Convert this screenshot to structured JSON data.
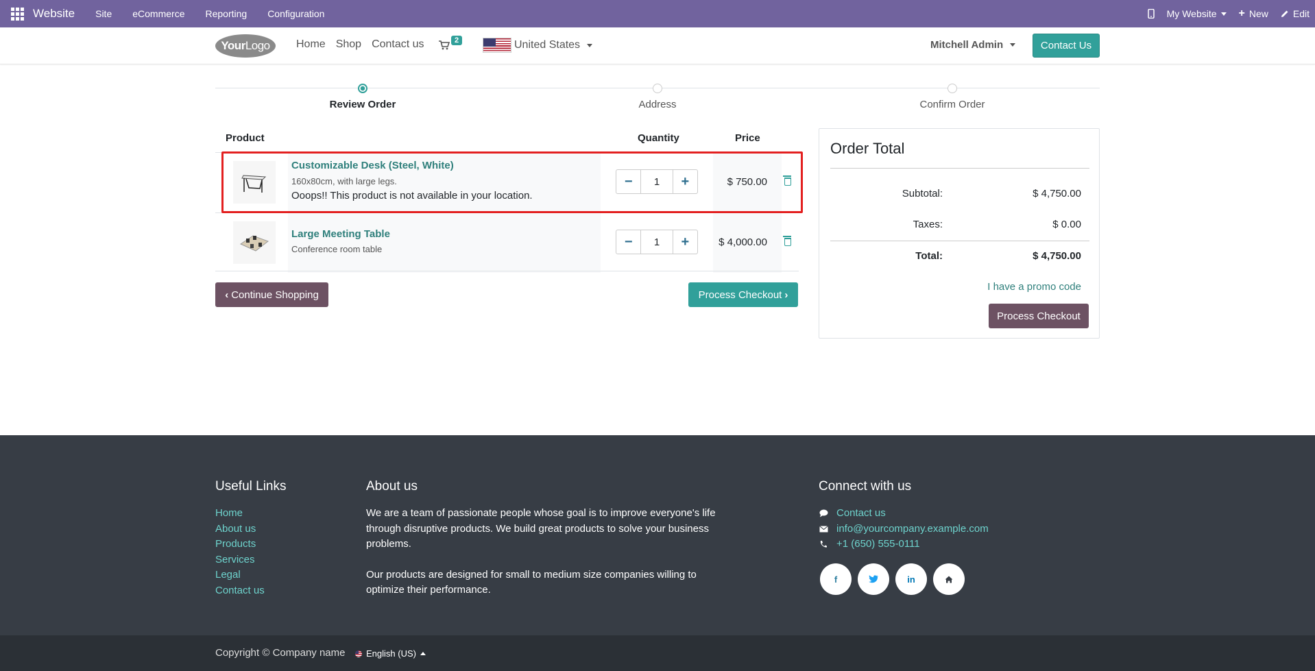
{
  "topbar": {
    "brand": "Website",
    "menus": [
      "Site",
      "eCommerce",
      "Reporting",
      "Configuration"
    ],
    "my_website": "My Website",
    "new": "New",
    "edit": "Edit"
  },
  "header": {
    "logo_your": "Your",
    "logo_logo": "Logo",
    "nav": [
      "Home",
      "Shop",
      "Contact us"
    ],
    "cart_count": "2",
    "country": "United States",
    "user": "Mitchell Admin",
    "contact_button": "Contact Us"
  },
  "wizard": {
    "steps": [
      "Review Order",
      "Address",
      "Confirm Order"
    ],
    "active_step": "Review Order"
  },
  "cart": {
    "headers": {
      "product": "Product",
      "quantity": "Quantity",
      "price": "Price"
    },
    "items": [
      {
        "name": "Customizable Desk (Steel, White)",
        "description": "160x80cm, with large legs.",
        "warning": "Ooops!! This product is not available in your location.",
        "quantity": "1",
        "price": "$ 750.00"
      },
      {
        "name": "Large Meeting Table",
        "description": "Conference room table",
        "quantity": "1",
        "price": "$ 4,000.00"
      }
    ],
    "continue_shopping": "Continue Shopping",
    "process_checkout": "Process Checkout"
  },
  "order_total": {
    "title": "Order Total",
    "subtotal_label": "Subtotal:",
    "subtotal_value": "$ 4,750.00",
    "taxes_label": "Taxes:",
    "taxes_value": "$ 0.00",
    "total_label": "Total:",
    "total_value": "$ 4,750.00",
    "promo": "I have a promo code",
    "checkout": "Process Checkout"
  },
  "footer": {
    "useful_links_title": "Useful Links",
    "useful_links": [
      "Home",
      "About us",
      "Products",
      "Services",
      "Legal",
      "Contact us"
    ],
    "about_title": "About us",
    "about_p1": "We are a team of passionate people whose goal is to improve everyone's life through disruptive products. We build great products to solve your business problems.",
    "about_p2": "Our products are designed for small to medium size companies willing to optimize their performance.",
    "connect_title": "Connect with us",
    "contact_link": "Contact us",
    "email": "info@yourcompany.example.com",
    "phone": "+1 (650) 555-0111",
    "socials": [
      "facebook-icon",
      "twitter-icon",
      "linkedin-icon",
      "home-icon"
    ],
    "copyright": "Copyright © Company name",
    "language": "English (US)"
  },
  "colors": {
    "topbar": "#71639e",
    "accent": "#31a09a",
    "dark_button": "#6d5263",
    "footer": "#373d45",
    "highlight": "#e32020"
  }
}
